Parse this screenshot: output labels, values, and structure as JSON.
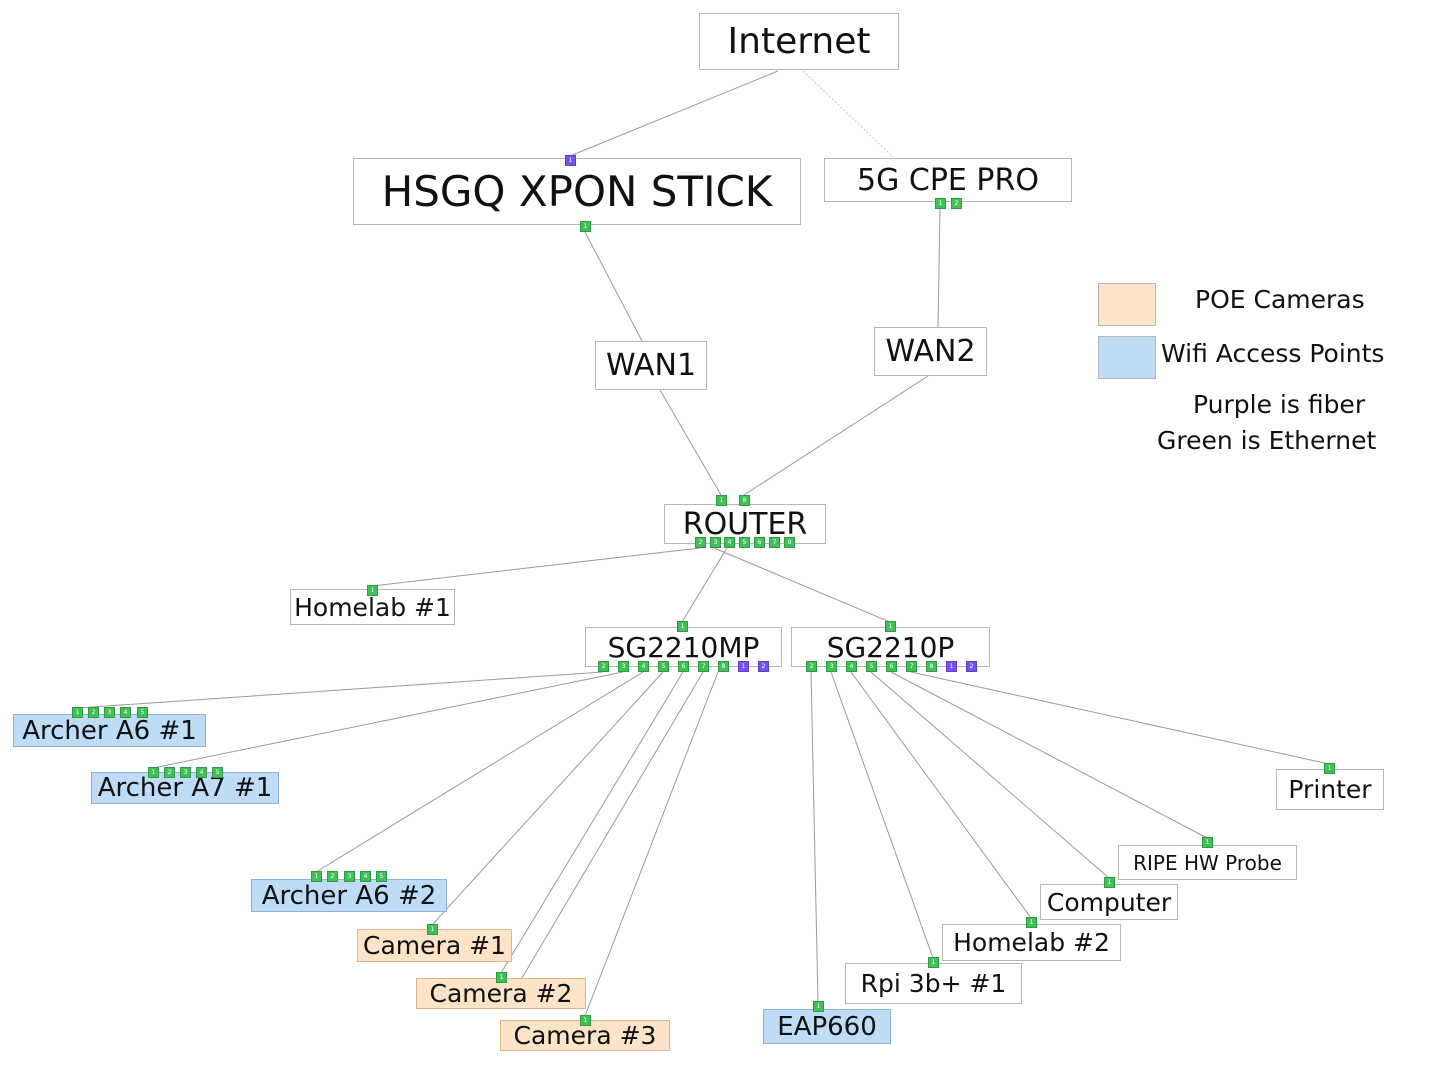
{
  "colors": {
    "ethernet": "#40c057",
    "fiber": "#7950f2",
    "wifi_fill": "#bfdcf7",
    "poe_fill": "#fde3c8",
    "edge": "#9a9a9a"
  },
  "nodes": {
    "internet": {
      "label": "Internet",
      "type": "plain",
      "ports": []
    },
    "xpon": {
      "label": "HSGQ XPON STICK",
      "type": "plain",
      "ports": [
        {
          "label": "1",
          "kind": "fiber"
        },
        {
          "label": "1",
          "kind": "ethernet"
        }
      ]
    },
    "cpe": {
      "label": "5G CPE PRO",
      "type": "plain",
      "ports": [
        {
          "label": "1",
          "kind": "ethernet"
        },
        {
          "label": "2",
          "kind": "ethernet"
        }
      ]
    },
    "wan1": {
      "label": "WAN1",
      "type": "plain",
      "ports": []
    },
    "wan2": {
      "label": "WAN2",
      "type": "plain",
      "ports": []
    },
    "router": {
      "label": "ROUTER",
      "type": "plain",
      "ports": [
        {
          "label": "1",
          "kind": "ethernet"
        },
        {
          "label": "8",
          "kind": "ethernet"
        },
        {
          "label": "2",
          "kind": "ethernet"
        },
        {
          "label": "3",
          "kind": "ethernet"
        },
        {
          "label": "4",
          "kind": "ethernet"
        },
        {
          "label": "5",
          "kind": "ethernet"
        },
        {
          "label": "6",
          "kind": "ethernet"
        },
        {
          "label": "7",
          "kind": "ethernet"
        },
        {
          "label": "9",
          "kind": "ethernet"
        }
      ]
    },
    "homelab1": {
      "label": "Homelab #1",
      "type": "plain",
      "ports": [
        {
          "label": "1",
          "kind": "ethernet"
        }
      ]
    },
    "sg2210mp": {
      "label": "SG2210MP",
      "type": "plain",
      "ports": [
        {
          "label": "1",
          "kind": "ethernet"
        },
        {
          "label": "2",
          "kind": "ethernet"
        },
        {
          "label": "3",
          "kind": "ethernet"
        },
        {
          "label": "4",
          "kind": "ethernet"
        },
        {
          "label": "5",
          "kind": "ethernet"
        },
        {
          "label": "6",
          "kind": "ethernet"
        },
        {
          "label": "7",
          "kind": "ethernet"
        },
        {
          "label": "8",
          "kind": "ethernet"
        },
        {
          "label": "1",
          "kind": "fiber"
        },
        {
          "label": "2",
          "kind": "fiber"
        }
      ]
    },
    "sg2210p": {
      "label": "SG2210P",
      "type": "plain",
      "ports": [
        {
          "label": "1",
          "kind": "ethernet"
        },
        {
          "label": "2",
          "kind": "ethernet"
        },
        {
          "label": "3",
          "kind": "ethernet"
        },
        {
          "label": "4",
          "kind": "ethernet"
        },
        {
          "label": "5",
          "kind": "ethernet"
        },
        {
          "label": "6",
          "kind": "ethernet"
        },
        {
          "label": "7",
          "kind": "ethernet"
        },
        {
          "label": "8",
          "kind": "ethernet"
        },
        {
          "label": "1",
          "kind": "fiber"
        },
        {
          "label": "2",
          "kind": "fiber"
        }
      ]
    },
    "archer_a6_1": {
      "label": "Archer A6 #1",
      "type": "wifi",
      "ports": [
        {
          "label": "1",
          "kind": "ethernet"
        },
        {
          "label": "2",
          "kind": "ethernet"
        },
        {
          "label": "3",
          "kind": "ethernet"
        },
        {
          "label": "4",
          "kind": "ethernet"
        },
        {
          "label": "5",
          "kind": "ethernet"
        }
      ]
    },
    "archer_a7_1": {
      "label": "Archer A7 #1",
      "type": "wifi",
      "ports": [
        {
          "label": "1",
          "kind": "ethernet"
        },
        {
          "label": "2",
          "kind": "ethernet"
        },
        {
          "label": "3",
          "kind": "ethernet"
        },
        {
          "label": "4",
          "kind": "ethernet"
        },
        {
          "label": "5",
          "kind": "ethernet"
        }
      ]
    },
    "archer_a6_2": {
      "label": "Archer A6 #2",
      "type": "wifi",
      "ports": [
        {
          "label": "1",
          "kind": "ethernet"
        },
        {
          "label": "2",
          "kind": "ethernet"
        },
        {
          "label": "3",
          "kind": "ethernet"
        },
        {
          "label": "4",
          "kind": "ethernet"
        },
        {
          "label": "5",
          "kind": "ethernet"
        }
      ]
    },
    "camera1": {
      "label": "Camera #1",
      "type": "poe",
      "ports": [
        {
          "label": "1",
          "kind": "ethernet"
        }
      ]
    },
    "camera2": {
      "label": "Camera #2",
      "type": "poe",
      "ports": [
        {
          "label": "1",
          "kind": "ethernet"
        }
      ]
    },
    "camera3": {
      "label": "Camera #3",
      "type": "poe",
      "ports": [
        {
          "label": "1",
          "kind": "ethernet"
        }
      ]
    },
    "eap660": {
      "label": "EAP660",
      "type": "wifi",
      "ports": [
        {
          "label": "1",
          "kind": "ethernet"
        }
      ]
    },
    "rpi": {
      "label": "Rpi 3b+ #1",
      "type": "plain",
      "ports": [
        {
          "label": "1",
          "kind": "ethernet"
        }
      ]
    },
    "homelab2": {
      "label": "Homelab #2",
      "type": "plain",
      "ports": [
        {
          "label": "1",
          "kind": "ethernet"
        }
      ]
    },
    "computer": {
      "label": "Computer",
      "type": "plain",
      "ports": [
        {
          "label": "1",
          "kind": "ethernet"
        }
      ]
    },
    "ripe": {
      "label": "RIPE HW Probe",
      "type": "plain",
      "ports": [
        {
          "label": "1",
          "kind": "ethernet"
        }
      ]
    },
    "printer": {
      "label": "Printer",
      "type": "plain",
      "ports": [
        {
          "label": "1",
          "kind": "ethernet"
        }
      ]
    }
  },
  "legend": {
    "poe": "POE Cameras",
    "wifi": "Wifi Access Points",
    "fiber_note": "Purple is fiber",
    "ethernet_note": "Green is Ethernet"
  }
}
